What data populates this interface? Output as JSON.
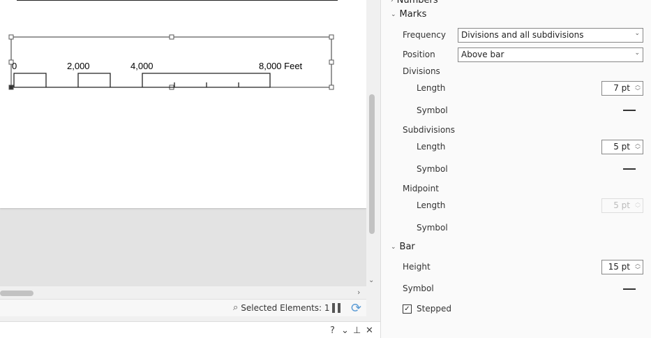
{
  "scalebar": {
    "labels": [
      "0",
      "2,000",
      "4,000",
      "8,000 Feet"
    ]
  },
  "status": {
    "selected": "Selected Elements: 1"
  },
  "pane": {
    "help": "?",
    "menu": "⌄",
    "pin": "⊥",
    "close": "✕"
  },
  "panel": {
    "numbers": "Numbers",
    "marks": {
      "title": "Marks",
      "frequency_label": "Frequency",
      "frequency": "Divisions and all subdivisions",
      "position_label": "Position",
      "position": "Above bar",
      "divisions": {
        "title": "Divisions",
        "length_label": "Length",
        "length": "7 pt",
        "symbol_label": "Symbol"
      },
      "subdivisions": {
        "title": "Subdivisions",
        "length_label": "Length",
        "length": "5 pt",
        "symbol_label": "Symbol"
      },
      "midpoint": {
        "title": "Midpoint",
        "length_label": "Length",
        "length": "5 pt",
        "symbol_label": "Symbol"
      }
    },
    "bar": {
      "title": "Bar",
      "height_label": "Height",
      "height": "15 pt",
      "symbol_label": "Symbol",
      "stepped_label": "Stepped",
      "stepped": true
    }
  }
}
